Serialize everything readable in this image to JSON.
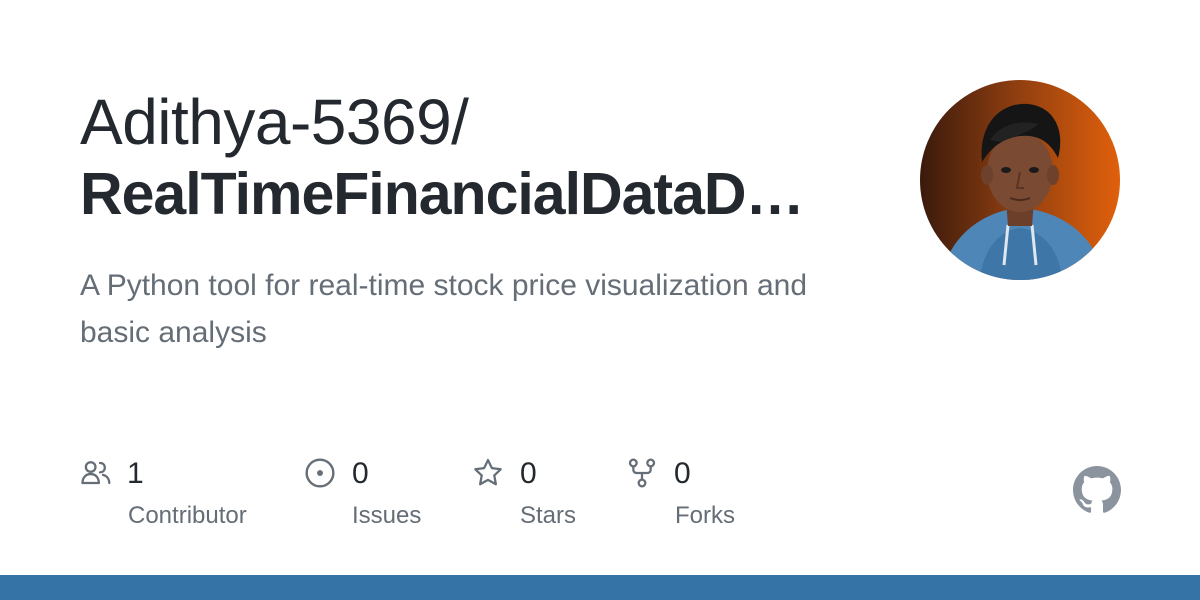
{
  "repo": {
    "owner": "Adithya-5369/",
    "name": "RealTimeFinancialDataD…",
    "description": "A Python tool for real-time stock price visualization and basic analysis"
  },
  "stats": {
    "contributors": {
      "value": "1",
      "label": "Contributor",
      "icon": "people-icon"
    },
    "issues": {
      "value": "0",
      "label": "Issues",
      "icon": "issue-opened-icon"
    },
    "stars": {
      "value": "0",
      "label": "Stars",
      "icon": "star-icon"
    },
    "forks": {
      "value": "0",
      "label": "Forks",
      "icon": "repo-forked-icon"
    }
  },
  "colors": {
    "language_bar": "#3572a5",
    "icon_gray": "#656d76",
    "text_primary": "#24292f",
    "text_secondary": "#656d76",
    "github_logo": "#8b949e"
  },
  "icons": {
    "brand": "github-mark-icon",
    "avatar": "owner-avatar"
  }
}
